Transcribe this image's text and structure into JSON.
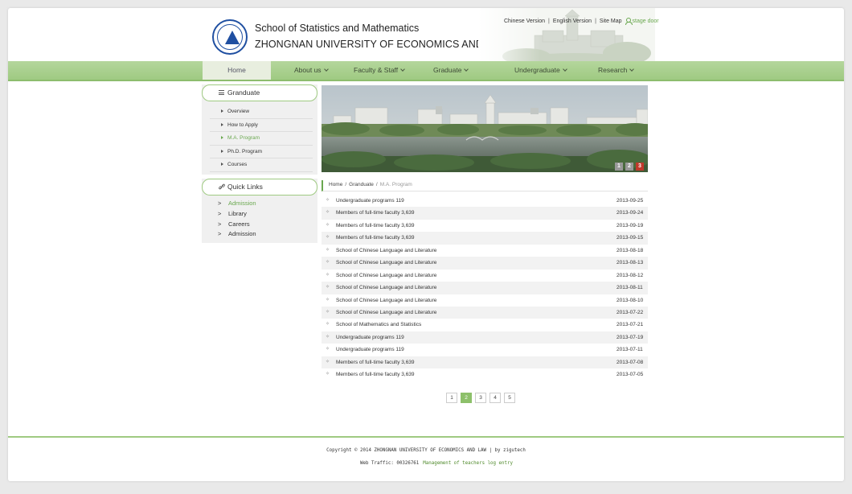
{
  "header": {
    "title_line1": "School of Statistics and Mathematics",
    "title_line2": "ZHONGNAN UNIVERSITY OF ECONOMICS AND LAW",
    "links": {
      "chinese": "Chinese Version",
      "english": "English Version",
      "sitemap": "Site Map",
      "stage": "stage door",
      "separator": "|"
    }
  },
  "nav": {
    "items": [
      {
        "label": "Home"
      },
      {
        "label": "About us"
      },
      {
        "label": "Faculty & Staff"
      },
      {
        "label": "Graduate"
      },
      {
        "label": "Undergraduate"
      },
      {
        "label": "Research"
      }
    ]
  },
  "sidebar": {
    "section_title": "Granduate",
    "items": [
      {
        "label": "Overview"
      },
      {
        "label": "How to Apply"
      },
      {
        "label": "M.A. Program",
        "active": true
      },
      {
        "label": "Ph.D. Program"
      },
      {
        "label": "Courses"
      }
    ],
    "quick_links_title": "Quick Links",
    "quick_links": [
      {
        "label": "Admission",
        "active": true
      },
      {
        "label": "Library"
      },
      {
        "label": "Careers"
      },
      {
        "label": "Admission"
      }
    ],
    "gt": ">"
  },
  "banner": {
    "pages": [
      "1",
      "2",
      "3"
    ],
    "active_page": "3"
  },
  "breadcrumb": {
    "home": "Home",
    "graduate": "Granduate",
    "current": "M.A. Program",
    "sep": "/"
  },
  "news": {
    "bullet": "✧",
    "rows": [
      {
        "title": "Undergraduate programs 119",
        "date": "2013-09-25"
      },
      {
        "title": "Members of full-time faculty 3,639",
        "date": "2013-09-24"
      },
      {
        "title": "Members of full-time faculty 3,639",
        "date": "2013-09-19"
      },
      {
        "title": "Members of full-time faculty 3,639",
        "date": "2013-09-15"
      },
      {
        "title": "School of Chinese Language and Literature",
        "date": "2013-08-18"
      },
      {
        "title": "School of Chinese Language and Literature",
        "date": "2013-08-13"
      },
      {
        "title": "School of Chinese Language and Literature",
        "date": "2013-08-12"
      },
      {
        "title": "School of Chinese Language and Literature",
        "date": "2013-08-11"
      },
      {
        "title": "School of Chinese Language and Literature",
        "date": "2013-08-10"
      },
      {
        "title": "School of Chinese Language and Literature",
        "date": "2013-07-22"
      },
      {
        "title": "School of Mathematics and Statistics",
        "date": "2013-07-21"
      },
      {
        "title": "Undergraduate programs 119",
        "date": "2013-07-19"
      },
      {
        "title": "Undergraduate programs 119",
        "date": "2013-07-11"
      },
      {
        "title": "Members of full-time faculty 3,639",
        "date": "2013-07-08"
      },
      {
        "title": "Members of full-time faculty 3,639",
        "date": "2013-07-05"
      }
    ]
  },
  "pagination": {
    "pages": [
      "1",
      "2",
      "3",
      "4",
      "5"
    ],
    "active": "2"
  },
  "footer": {
    "copyright": "Copyright © 2014 ZHONGNAN UNIVERSITY OF ECONOMICS AND LAW | by zigutech",
    "traffic_label": "Web Traffic: 00326761",
    "management": "Management of teachers log entry"
  },
  "colors": {
    "accent": "#9fca82",
    "accent_text": "#6aa84f",
    "active_page": "#8dc06a",
    "banner_active": "#c0392b"
  }
}
